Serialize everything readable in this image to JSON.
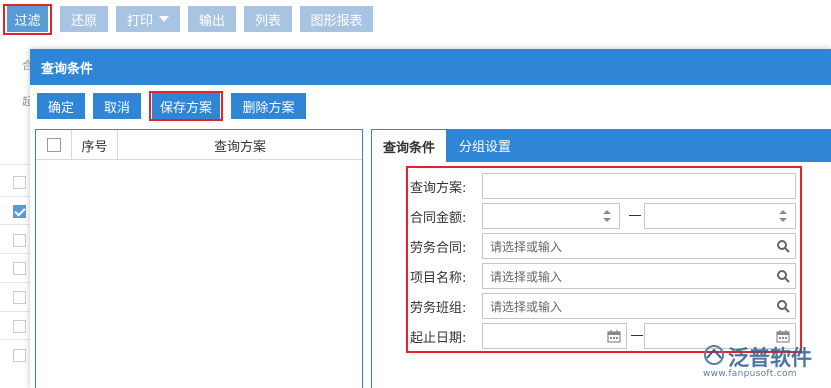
{
  "toolbar": {
    "filter": "过滤",
    "restore": "还原",
    "print": "打印",
    "export": "输出",
    "list": "列表",
    "chart_report": "图形报表"
  },
  "background": {
    "row_hint_1": "合",
    "row_hint_2": "起"
  },
  "dialog": {
    "title": "查询条件",
    "actions": {
      "confirm": "确定",
      "cancel": "取消",
      "save_scheme": "保存方案",
      "delete_scheme": "删除方案"
    },
    "scheme_table": {
      "col_index": "序号",
      "col_scheme": "查询方案"
    },
    "tabs": {
      "conditions": "查询条件",
      "grouping": "分组设置"
    },
    "form": {
      "scheme_label": "查询方案:",
      "amount_label": "合同金额:",
      "labor_contract_label": "劳务合同:",
      "labor_contract_placeholder": "请选择或输入",
      "project_label": "项目名称:",
      "project_placeholder": "请选择或输入",
      "labor_team_label": "劳务班组:",
      "labor_team_placeholder": "请选择或输入",
      "date_label": "起止日期:",
      "range_dash": "—"
    }
  },
  "watermark": {
    "brand": "泛普软件",
    "url": "www.fanpusoft.com"
  },
  "colors": {
    "primary": "#2f86d6",
    "toolbar_inactive": "#a9c4e2",
    "highlight": "#e3242b"
  }
}
